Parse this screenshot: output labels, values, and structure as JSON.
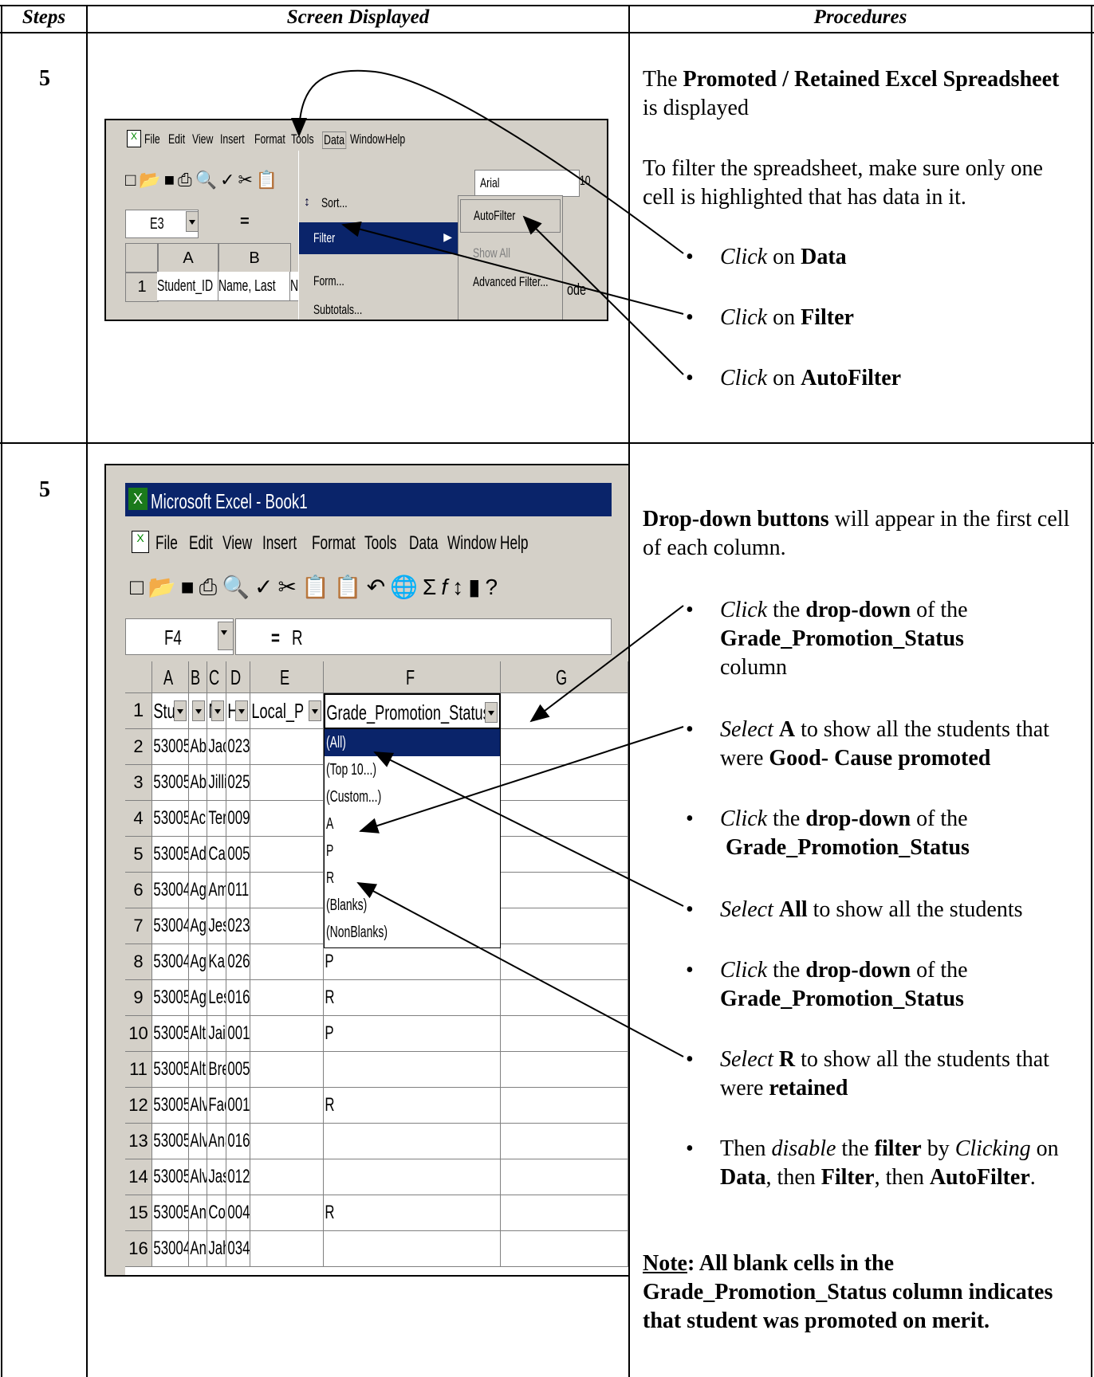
{
  "headers": {
    "steps": "Steps",
    "screen": "Screen Displayed",
    "procedures": "Procedures"
  },
  "row1": {
    "step": "5",
    "intro_pre": "The ",
    "intro_bold": "Promoted / Retained Excel Spreadsheet",
    "intro_post": " is displayed",
    "filter_note": "To filter the spreadsheet, make sure only one cell is highlighted that has data in it.",
    "bullets": [
      {
        "verb": "Click",
        "mid": " on ",
        "target": "Data"
      },
      {
        "verb": "Click",
        "mid": " on ",
        "target": "Filter"
      },
      {
        "verb": "Click",
        "mid": " on ",
        "target": "AutoFilter"
      }
    ]
  },
  "excel1": {
    "menubar": [
      "File",
      "Edit",
      "View",
      "Insert",
      "Format",
      "Tools",
      "Data",
      "Window",
      "Help"
    ],
    "data_menu": [
      "Sort...",
      "Filter",
      "Form...",
      "Subtotals..."
    ],
    "filter_submenu": [
      "AutoFilter",
      "Show All",
      "Advanced Filter..."
    ],
    "name_box": "E3",
    "equals": "=",
    "font_box": "Arial",
    "font_size": "10",
    "col_headers": [
      "A",
      "B"
    ],
    "row1": [
      "Student_ID",
      "Name, Last",
      "Na"
    ],
    "row_num": "1",
    "cut_text": "ode"
  },
  "row2": {
    "step": "5",
    "intro_bold": "Drop-down buttons",
    "intro_post": " will appear in the first cell of each column.",
    "b1": {
      "verb": "Click",
      "mid": " the ",
      "bold1": "drop-down",
      "mid2": " of the ",
      "bold2": "Grade_Promotion_Status",
      "tail": " column"
    },
    "b2": {
      "verb": "Select",
      "mid": " ",
      "bold1": "A",
      "mid2": " to show all the students that were ",
      "bold2": "Good- Cause promoted"
    },
    "b3": {
      "verb": "Click",
      "mid": " the ",
      "bold1": "drop-down",
      "mid2": " of the ",
      "bold2": "Grade_Promotion_Status"
    },
    "b4": {
      "verb": "Select",
      "mid": " ",
      "bold1": "All",
      "mid2": " to show all the students"
    },
    "b5": {
      "verb": "Click",
      "mid": " the ",
      "bold1": "drop-down",
      "mid2": " of the ",
      "bold2": "Grade_Promotion_Status"
    },
    "b6": {
      "verb": "Select",
      "mid": " ",
      "bold1": "R",
      "mid2": " to show all the students that were ",
      "bold2": "retained"
    },
    "b7": {
      "pre": "Then ",
      "verb": "disable",
      "mid": " the ",
      "bold1": "filter",
      "mid2": " by ",
      "verb2": "Clicking",
      "mid3": " on ",
      "bold2": "Data",
      "mid4": ", then ",
      "bold3": "Filter",
      "mid5": ", then ",
      "bold4": "AutoFilter",
      "tail": "."
    },
    "note_u": "Note",
    "note_rest": ": All blank cells in the Grade_Promotion_Status column indicates that student was promoted on merit."
  },
  "excel2": {
    "title": "Microsoft Excel - Book1",
    "menubar": [
      "File",
      "Edit",
      "View",
      "Insert",
      "Format",
      "Tools",
      "Data",
      "Window",
      "Help"
    ],
    "name_box": "F4",
    "equals": "=",
    "formula": "R",
    "col_headers": [
      "A",
      "B",
      "C",
      "D",
      "E",
      "F",
      "G"
    ],
    "header_row": [
      "Stu",
      "",
      "N",
      "H",
      "Local_P",
      "Grade_Promotion_Status"
    ],
    "rows": [
      {
        "n": "2",
        "a": "53005",
        "b": "Ab",
        "c": "Jac",
        "d": "023",
        "f": ""
      },
      {
        "n": "3",
        "a": "53005",
        "b": "Ab",
        "c": "Jilli",
        "d": "025",
        "f": ""
      },
      {
        "n": "4",
        "a": "53005",
        "b": "Ac",
        "c": "Ter",
        "d": "009",
        "f": ""
      },
      {
        "n": "5",
        "a": "53005",
        "b": "Ad",
        "c": "Cai",
        "d": "005",
        "f": ""
      },
      {
        "n": "6",
        "a": "53004",
        "b": "Ag",
        "c": "Am",
        "d": "011",
        "f": ""
      },
      {
        "n": "7",
        "a": "53004",
        "b": "Ag",
        "c": "Jes",
        "d": "023",
        "f": ""
      },
      {
        "n": "8",
        "a": "53004",
        "b": "Ag",
        "c": "Kar",
        "d": "026",
        "f": "P"
      },
      {
        "n": "9",
        "a": "53005",
        "b": "Ag",
        "c": "Les",
        "d": "016",
        "f": "R"
      },
      {
        "n": "10",
        "a": "53005",
        "b": "Alt",
        "c": "Jail",
        "d": "001",
        "f": "P"
      },
      {
        "n": "11",
        "a": "53005",
        "b": "Alt",
        "c": "Bre",
        "d": "005",
        "f": ""
      },
      {
        "n": "12",
        "a": "53005",
        "b": "Alv",
        "c": "Fac",
        "d": "001",
        "f": "R"
      },
      {
        "n": "13",
        "a": "53005",
        "b": "Alv",
        "c": "Ana",
        "d": "016",
        "f": ""
      },
      {
        "n": "14",
        "a": "53005",
        "b": "Alv",
        "c": "Jas",
        "d": "012",
        "f": ""
      },
      {
        "n": "15",
        "a": "53005",
        "b": "An",
        "c": "Colt",
        "d": "004",
        "f": "R"
      },
      {
        "n": "16",
        "a": "53004",
        "b": "An",
        "c": "Jah",
        "d": "034",
        "f": ""
      }
    ],
    "dropdown_list": [
      "(All)",
      "(Top 10...)",
      "(Custom...)",
      "A",
      "P",
      "R",
      "(Blanks)",
      "(NonBlanks)"
    ]
  }
}
